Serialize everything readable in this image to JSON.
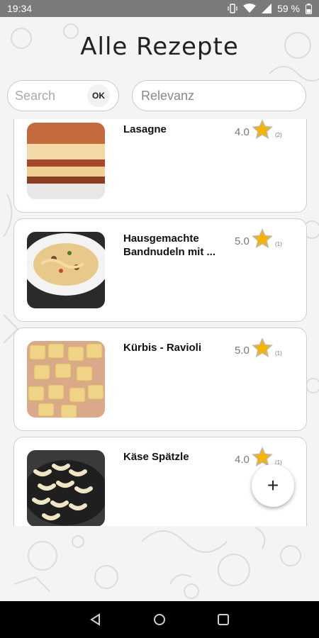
{
  "status": {
    "time": "19:34",
    "battery": "59 %"
  },
  "header": {
    "title": "Alle Rezepte"
  },
  "search": {
    "placeholder": "Search",
    "ok_label": "OK"
  },
  "sort": {
    "selected": "Relevanz"
  },
  "recipes": [
    {
      "name": "Lasagne",
      "rating": "4.0",
      "count": "(2)"
    },
    {
      "name": "Hausgemachte Bandnudeln mit ...",
      "rating": "5.0",
      "count": "(1)"
    },
    {
      "name": "Kürbis - Ravioli",
      "rating": "5.0",
      "count": "(1)"
    },
    {
      "name": "Käse Spätzle",
      "rating": "4.0",
      "count": "(1)"
    }
  ],
  "fab": {
    "label": "+",
    "icon": "plus-icon"
  },
  "colors": {
    "star": "#f5b400",
    "fab_bg": "#ffffff",
    "status_bar": "#7a7a7a"
  }
}
